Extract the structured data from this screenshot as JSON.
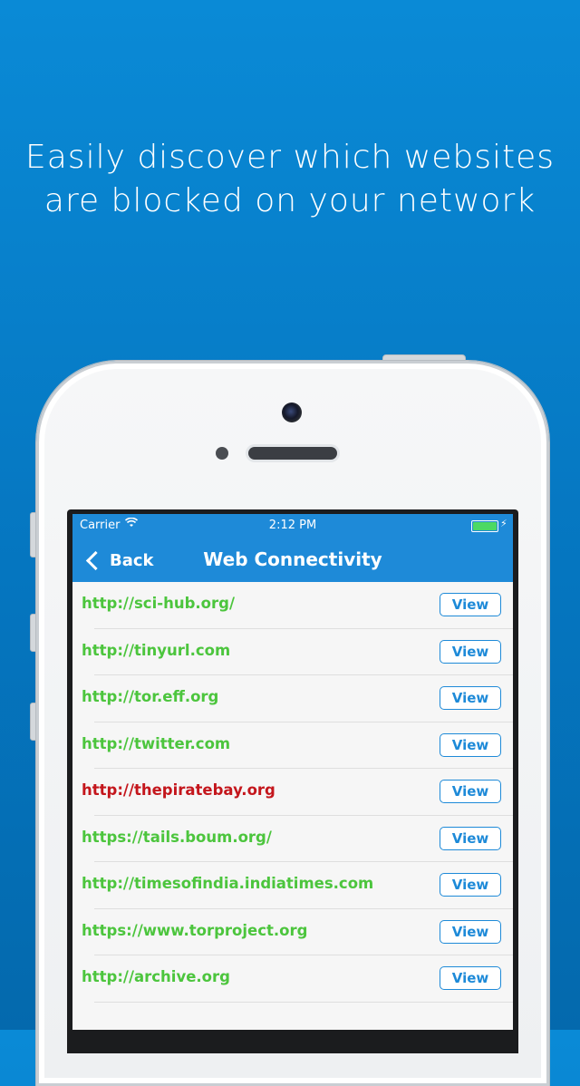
{
  "headline": {
    "line1": "Easily discover which websites",
    "line2": "are blocked on your network"
  },
  "status_bar": {
    "carrier": "Carrier",
    "wifi_icon": "wifi-icon",
    "time": "2:12 PM",
    "battery_icon": "battery-charging-icon",
    "battery_level": 1.0
  },
  "nav": {
    "back_label": "Back",
    "back_icon": "chevron-left-icon",
    "title": "Web Connectivity"
  },
  "colors": {
    "background": "#0a8ad6",
    "nav_bar": "#1e8ad8",
    "accessible": "#4cc53d",
    "blocked": "#c4161c"
  },
  "sites": [
    {
      "url": "http://sci-hub.org/",
      "status": "accessible",
      "action": "View"
    },
    {
      "url": "http://tinyurl.com",
      "status": "accessible",
      "action": "View"
    },
    {
      "url": "http://tor.eff.org",
      "status": "accessible",
      "action": "View"
    },
    {
      "url": "http://twitter.com",
      "status": "accessible",
      "action": "View"
    },
    {
      "url": "http://thepiratebay.org",
      "status": "blocked",
      "action": "View"
    },
    {
      "url": "https://tails.boum.org/",
      "status": "accessible",
      "action": "View"
    },
    {
      "url": "http://timesofindia.indiatimes.com",
      "status": "accessible",
      "action": "View"
    },
    {
      "url": "https://www.torproject.org",
      "status": "accessible",
      "action": "View"
    },
    {
      "url": "http://archive.org",
      "status": "accessible",
      "action": "View"
    }
  ]
}
